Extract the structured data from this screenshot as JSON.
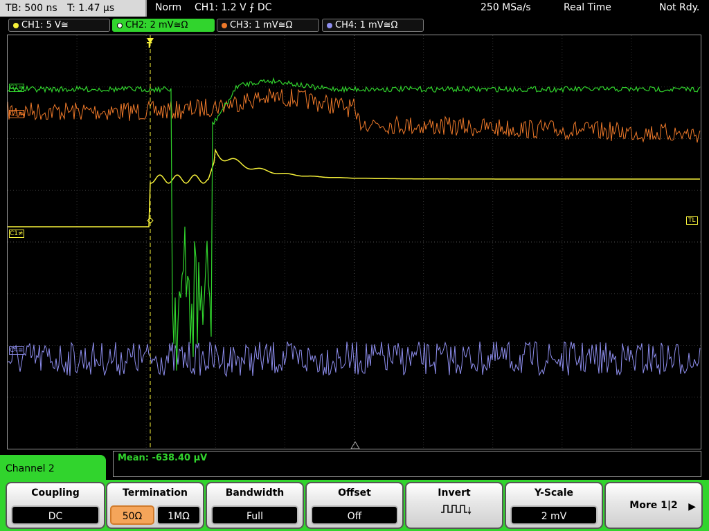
{
  "status": {
    "timebase": "TB: 500 ns",
    "trigger_time": "T: 1.47 µs",
    "mode": "Norm",
    "trigger_info": "CH1: 1.2 V ⨍ DC",
    "sample_rate": "250 MSa/s",
    "acq_mode": "Real Time",
    "state": "Not Rdy."
  },
  "channels": [
    {
      "label": "CH1: 5 V≅",
      "color": "#f7f23a"
    },
    {
      "label": "CH2: 2 mV≅Ω",
      "color": "#31d42d"
    },
    {
      "label": "CH3: 1 mV≅Ω",
      "color": "#f07a2a"
    },
    {
      "label": "CH4: 1 mV≅Ω",
      "color": "#8f8ff0"
    }
  ],
  "markers": {
    "ch2": "C2≅",
    "ch3": "C3≅",
    "ch1": "C1≠",
    "ch4": "C4≅",
    "trigger_level": "TL",
    "trigger_pos": "T"
  },
  "measurement": "Mean: -638.40 µV",
  "menu": {
    "title": "Channel 2",
    "coupling": {
      "label": "Coupling",
      "value": "DC"
    },
    "termination": {
      "label": "Termination",
      "opt1": "50Ω",
      "opt2": "1MΩ"
    },
    "bandwidth": {
      "label": "Bandwidth",
      "value": "Full"
    },
    "offset": {
      "label": "Offset",
      "value": "Off"
    },
    "invert": {
      "label": "Invert",
      "icon": "inverted-square-wave-icon"
    },
    "yscale": {
      "label": "Y-Scale",
      "value": "2 mV"
    },
    "more": {
      "label": "More 1|2"
    }
  }
}
